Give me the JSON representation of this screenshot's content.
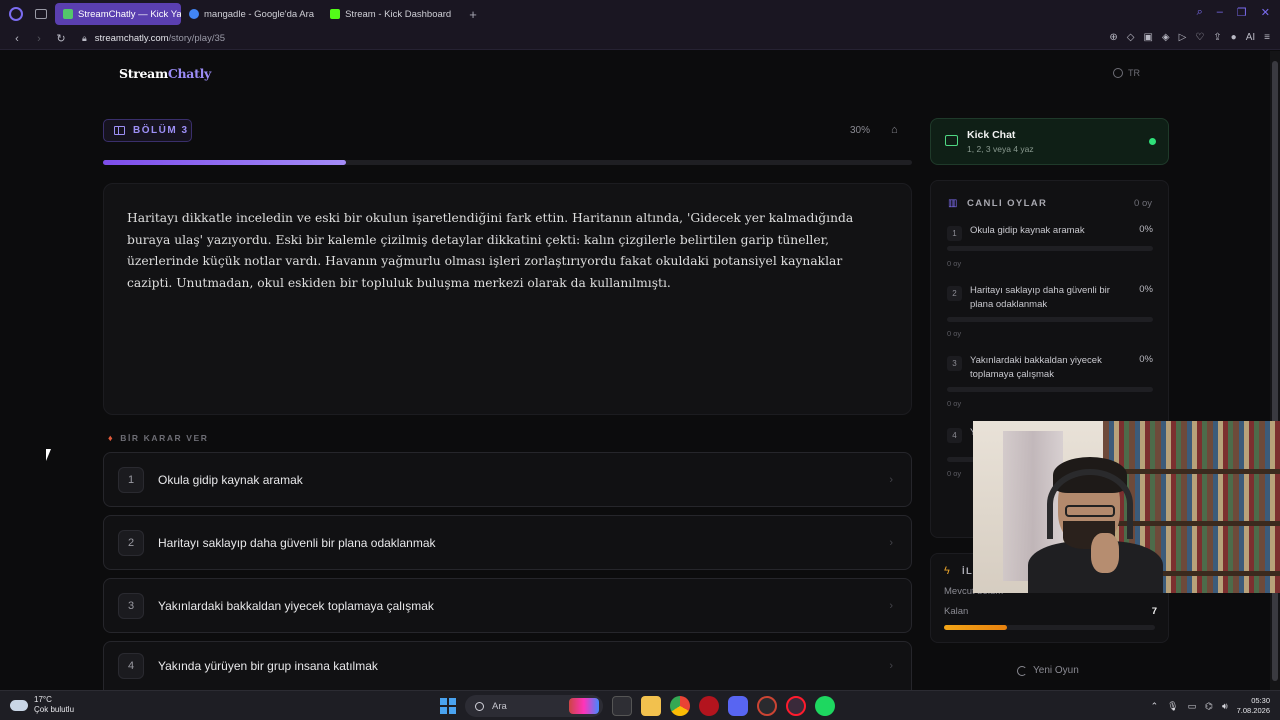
{
  "browser": {
    "tabs": [
      {
        "label": "StreamChatly — Kick Yayın",
        "active": true,
        "favicon_color": "#53c66b"
      },
      {
        "label": "mangadle - Google'da Ara",
        "active": false,
        "favicon_color": "#4285f4"
      },
      {
        "label": "Stream - Kick Dashboard",
        "active": false,
        "favicon_color": "#53fc18"
      }
    ],
    "url_host": "streamchatly.com",
    "url_path": "/story/play/35"
  },
  "site": {
    "logo_part1": "Stream",
    "logo_part2": "Chatly",
    "language": "TR"
  },
  "story": {
    "chapter_label": "BÖLÜM 3",
    "progress_text": "30%",
    "progress_value": 0.3,
    "text": "Haritayı dikkatle inceledin ve eski bir okulun işaretlendiğini fark ettin. Haritanın altında, 'Gidecek yer kalmadığında buraya ulaş' yazıyordu. Eski bir kalemle çizilmiş detaylar dikkatini çekti: kalın çizgilerle belirtilen garip tüneller, üzerlerinde küçük notlar vardı. Havanın yağmurlu olması işleri zorlaştırıyordu fakat okuldaki potansiyel kaynaklar cazipti. Unutmadan, okul eskiden bir topluluk buluşma merkezi olarak da kullanılmıştı.",
    "decide_label": "BİR KARAR VER",
    "choices": [
      {
        "num": "1",
        "text": "Okula gidip kaynak aramak"
      },
      {
        "num": "2",
        "text": "Haritayı saklayıp daha güvenli bir plana odaklanmak"
      },
      {
        "num": "3",
        "text": "Yakınlardaki bakkaldan yiyecek toplamaya çalışmak"
      },
      {
        "num": "4",
        "text": "Yakında yürüyen bir grup insana katılmak"
      }
    ]
  },
  "sidebar": {
    "kick_title": "Kick Chat",
    "kick_sub": "1, 2, 3 veya 4 yaz",
    "kick_status_color": "#2fe079",
    "votes_title": "CANLI OYLAR",
    "votes_total": "0 oy",
    "votes": [
      {
        "num": "1",
        "text": "Okula gidip kaynak aramak",
        "pct": "0%",
        "count": "0 oy"
      },
      {
        "num": "2",
        "text": "Haritayı saklayıp daha güvenli bir plana odaklanmak",
        "pct": "0%",
        "count": "0 oy"
      },
      {
        "num": "3",
        "text": "Yakınlardaki bakkaldan yiyecek toplamaya çalışmak",
        "pct": "0%",
        "count": "0 oy"
      },
      {
        "num": "4",
        "text": "Ya",
        "pct": "",
        "count": "0 oy"
      }
    ],
    "stats_title": "İLE",
    "stats_current_label": "Mevcut bölüm",
    "stats_remaining_label": "Kalan",
    "stats_remaining_value": "7",
    "stats_progress_value": 0.3,
    "new_game_label": "Yeni Oyun"
  },
  "taskbar": {
    "temp": "17°C",
    "weather": "Çok bulutlu",
    "search_placeholder": "Ara",
    "time": "05:30",
    "date": "7.08.2026"
  }
}
